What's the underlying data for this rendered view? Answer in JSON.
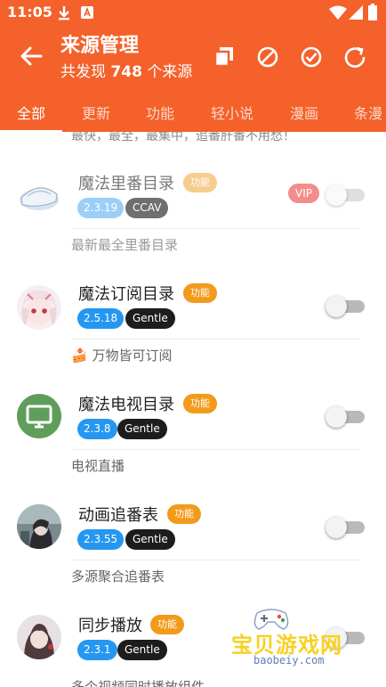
{
  "status_bar": {
    "time": "11:05"
  },
  "header": {
    "title": "来源管理",
    "subtitle_prefix": "共发现",
    "count": "748",
    "subtitle_suffix": "个来源"
  },
  "tabs": [
    {
      "label": "全部"
    },
    {
      "label": "更新"
    },
    {
      "label": "功能"
    },
    {
      "label": "轻小说"
    },
    {
      "label": "漫画"
    },
    {
      "label": "条漫"
    }
  ],
  "cut_text": "最快，最全，最集中，追番肝番不用愁！",
  "items": [
    {
      "name": "魔法里番目录",
      "tag": "功能",
      "version": "2.3.19",
      "badge": "CCAV",
      "vip": "VIP",
      "enabled": false,
      "dimmed": true,
      "avatar": "glass-icon",
      "description": "最新最全里番目录"
    },
    {
      "name": "魔法订阅目录",
      "tag": "功能",
      "version": "2.5.18",
      "badge": "Gentle",
      "enabled": false,
      "avatar": "anime-avatar",
      "description": "🍰 万物皆可订阅"
    },
    {
      "name": "魔法电视目录",
      "tag": "功能",
      "version": "2.3.8",
      "badge": "Gentle",
      "enabled": false,
      "avatar": "tv-icon",
      "description": "电视直播"
    },
    {
      "name": "动画追番表",
      "tag": "功能",
      "version": "2.3.55",
      "badge": "Gentle",
      "enabled": false,
      "avatar": "anime-avatar",
      "description": "多源聚合追番表"
    },
    {
      "name": "同步播放",
      "tag": "功能",
      "version": "2.3.1",
      "badge": "Gentle",
      "enabled": false,
      "avatar": "anime-avatar",
      "description": "多个视频同时播放组件"
    }
  ],
  "watermark": {
    "text": "宝贝游戏网",
    "url": "baobeiy.com"
  },
  "colors": {
    "accent": "#f4612b",
    "tag": "#f29a1b",
    "version": "#2597f1",
    "badge": "#1d1d1d",
    "vip": "#f38d8d"
  }
}
